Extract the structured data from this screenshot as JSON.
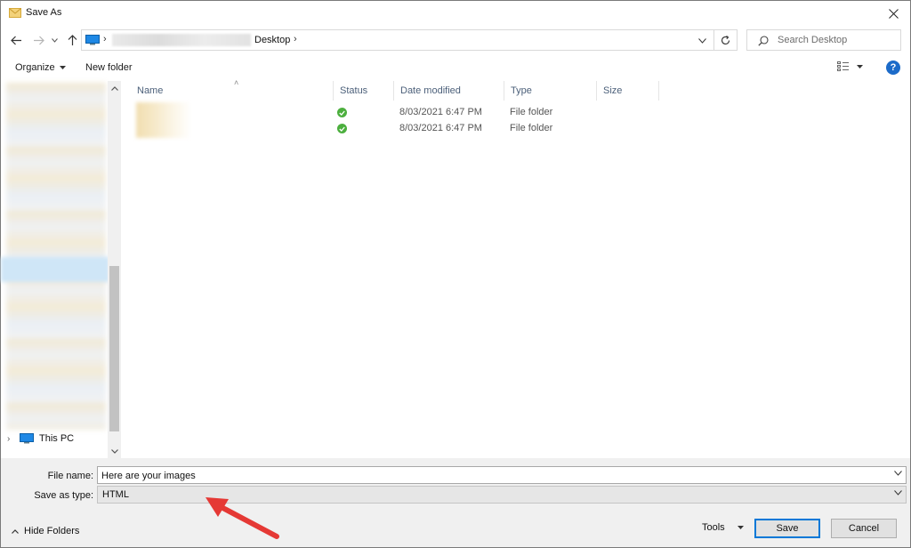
{
  "window": {
    "title": "Save As"
  },
  "address": {
    "breadcrumb": [
      "Desktop"
    ],
    "search_placeholder": "Search Desktop"
  },
  "toolbar": {
    "organize_label": "Organize",
    "new_folder_label": "New folder",
    "help_label": "?"
  },
  "navpane": {
    "this_pc_label": "This PC"
  },
  "filelist": {
    "columns": [
      "Name",
      "Status",
      "Date modified",
      "Type",
      "Size"
    ],
    "rows": [
      {
        "name": "",
        "status": "ok",
        "date_modified": "8/03/2021 6:47 PM",
        "type": "File folder",
        "size": ""
      },
      {
        "name": "",
        "status": "ok",
        "date_modified": "8/03/2021 6:47 PM",
        "type": "File folder",
        "size": ""
      }
    ]
  },
  "bottom": {
    "file_name_label": "File name:",
    "file_name_value": "Here are your images",
    "save_type_label": "Save as type:",
    "save_type_value": "HTML",
    "hide_folders_label": "Hide Folders",
    "tools_label": "Tools",
    "save_label": "Save",
    "cancel_label": "Cancel"
  },
  "colors": {
    "accent": "#0078d7",
    "status_ok": "#4caf3e",
    "annotation_arrow": "#e53935",
    "column_header_text": "#4c607a"
  }
}
